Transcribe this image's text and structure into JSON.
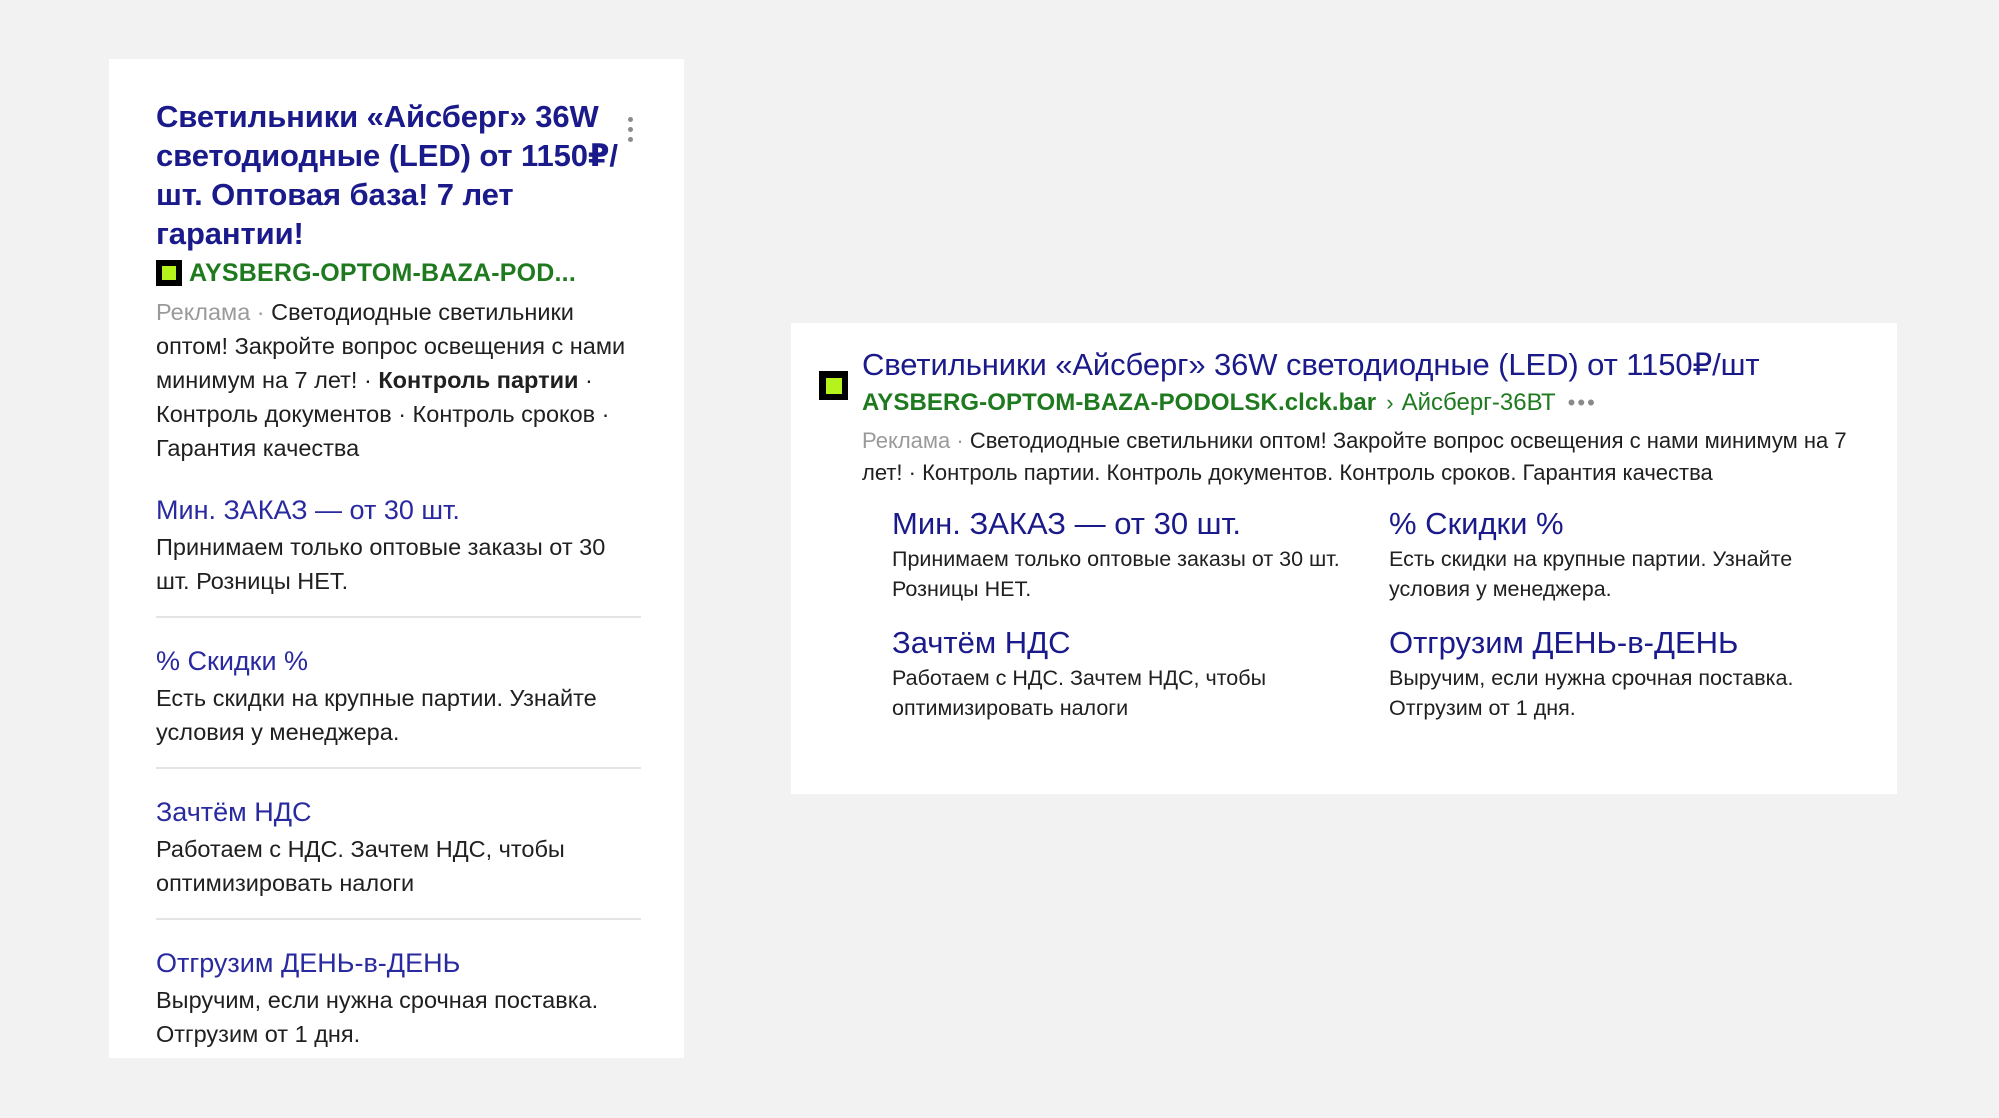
{
  "mobile": {
    "title": "Светильники «Айсберг» 36W светодиодные (LED) от 1150₽/шт. Оптовая база! 7 лет гарантии!",
    "favicon_icon": "green-square-favicon",
    "url": "AYSBERG-OPTOM-BAZA-POD...",
    "ad_label": "Реклама",
    "separator": " · ",
    "desc_main": "Светодиодные светильники оптом! Закройте вопрос освещения с нами минимум на 7 лет!",
    "desc_bold": "Контроль партии",
    "desc_tail": " · Контроль документов · Контроль сроков · Гарантия качества",
    "sitelinks": [
      {
        "title": "Мин. ЗАКАЗ — от 30 шт.",
        "desc": "Принимаем только оптовые заказы от 30 шт. Розницы НЕТ."
      },
      {
        "title": "% Скидки %",
        "desc": "Есть скидки на крупные партии. Узнайте условия у менеджера."
      },
      {
        "title": "Зачтём НДС",
        "desc": "Работаем с НДС. Зачтем НДС, чтобы оптимизировать налоги"
      },
      {
        "title": "Отгрузим ДЕНЬ-в-ДЕНЬ",
        "desc": "Выручим, если нужна срочная поставка. Отгрузим от 1 дня."
      }
    ]
  },
  "desktop": {
    "title": "Светильники «Айсберг» 36W светодиодные (LED) от 1150₽/шт",
    "url": "AYSBERG-OPTOM-BAZA-PODOLSK.clck.bar",
    "breadcrumb_sep": "›",
    "breadcrumb": "Айсберг-36ВТ",
    "more": "•••",
    "ad_label": "Реклама",
    "separator": " · ",
    "desc": "Светодиодные светильники оптом! Закройте вопрос освещения с нами минимум на 7 лет! · Контроль партии. Контроль документов. Контроль сроков. Гарантия качества",
    "sitelinks": [
      {
        "title": "Мин. ЗАКАЗ — от 30 шт.",
        "desc": "Принимаем только оптовые заказы от 30 шт. Розницы НЕТ."
      },
      {
        "title": "% Скидки %",
        "desc": "Есть скидки на крупные партии. Узнайте условия у менеджера."
      },
      {
        "title": "Зачтём НДС",
        "desc": "Работаем с НДС. Зачтем НДС, чтобы оптимизировать налоги"
      },
      {
        "title": "Отгрузим ДЕНЬ-в-ДЕНЬ",
        "desc": "Выручим, если нужна срочная поставка. Отгрузим от 1 дня."
      }
    ]
  },
  "colors": {
    "title": "#1a1a8a",
    "url": "#1f7a1f",
    "favicon_fill": "#b6f21b",
    "ad_label": "#9a9a9a",
    "background": "#f2f2f2"
  }
}
